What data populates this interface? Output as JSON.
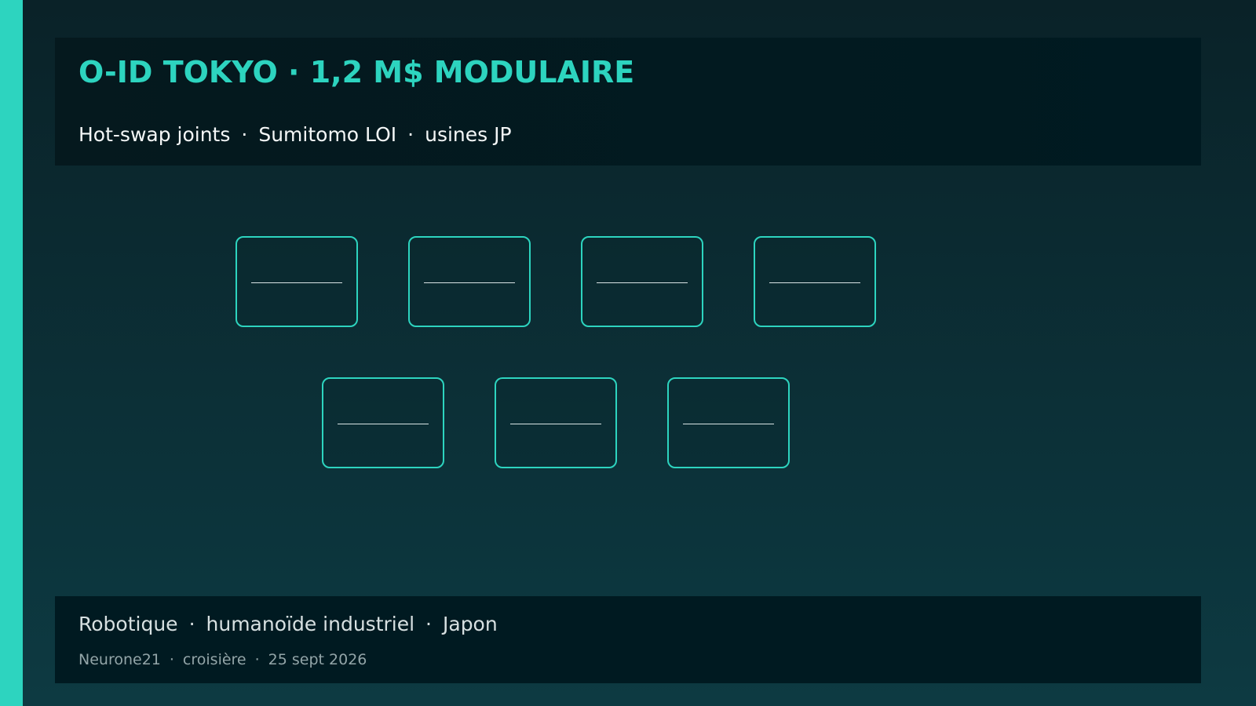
{
  "header": {
    "title": "O-ID TOKYO · 1,2 M$ MODULAIRE",
    "subtitle": [
      "Hot-swap joints",
      "Sumitomo LOI",
      "usines JP"
    ]
  },
  "modules": {
    "row1_count": 4,
    "row2_count": 3
  },
  "footer": {
    "line1": [
      "Robotique",
      "humanoïde industriel",
      "Japon"
    ],
    "line2": [
      "Neurone21",
      "croisière",
      "25 sept 2026"
    ]
  },
  "colors": {
    "accent": "#2dd4bf",
    "background_top": "#0a2228",
    "background_bottom": "#0d3a42",
    "panel": "#001a21"
  },
  "separator": "·"
}
